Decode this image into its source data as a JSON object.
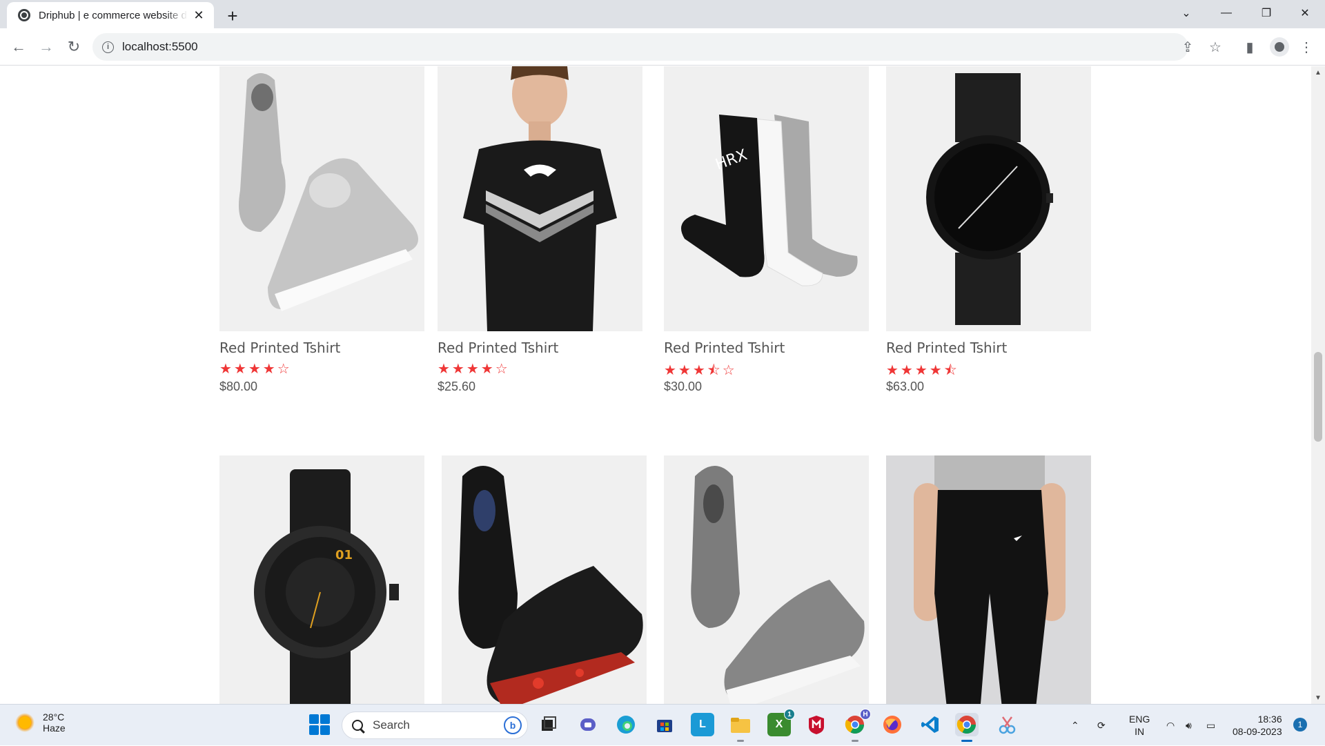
{
  "browser": {
    "tab_title": "Driphub | e commerce website design",
    "url": "localhost:5500",
    "new_tab_icon": "plus-icon",
    "back_icon": "back-arrow-icon",
    "forward_icon": "forward-arrow-icon",
    "reload_icon": "reload-icon"
  },
  "products": [
    {
      "name": "Red Printed Tshirt",
      "rating": 4,
      "stars": "★★★★☆",
      "price": "$80.00",
      "image": "grey-sneakers"
    },
    {
      "name": "Red Printed Tshirt",
      "rating": 4,
      "stars": "★★★★☆",
      "price": "$25.60",
      "image": "black-tshirt"
    },
    {
      "name": "Red Printed Tshirt",
      "rating": 3.5,
      "stars": "★★★⯪☆",
      "price": "$30.00",
      "image": "socks"
    },
    {
      "name": "Red Printed Tshirt",
      "rating": 4.5,
      "stars": "★★★★⯪",
      "price": "$63.00",
      "image": "black-watch"
    },
    {
      "name": "",
      "image": "leather-watch"
    },
    {
      "name": "",
      "image": "black-red-sneakers"
    },
    {
      "name": "",
      "image": "grey-slip-on-shoes"
    },
    {
      "name": "",
      "image": "black-joggers"
    }
  ],
  "colors": {
    "star": "#ef3636",
    "text": "#555555",
    "thumb_bg": "#f0f0f0"
  },
  "taskbar": {
    "weather_temp": "28°C",
    "weather_desc": "Haze",
    "search_placeholder": "Search",
    "lang_line1": "ENG",
    "lang_line2": "IN",
    "time": "18:36",
    "date": "08-09-2023",
    "notification_count": "1",
    "xbox_badge": "1",
    "chrome_badge": "H"
  }
}
